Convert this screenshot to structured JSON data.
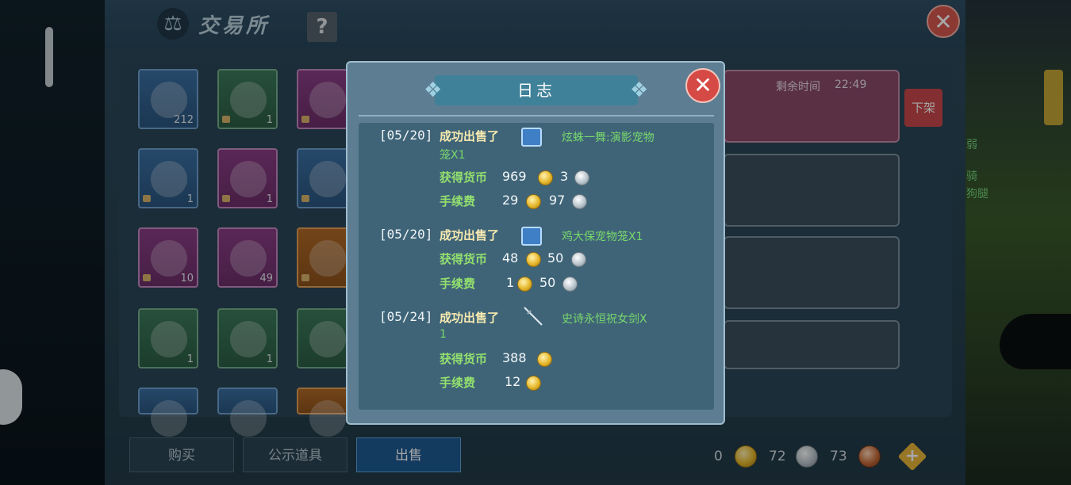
{
  "window": {
    "title": "交易所",
    "title_icon": "scales-icon",
    "help_label": "?",
    "close_label": "✕"
  },
  "inventory": [
    {
      "rarity": "blue",
      "icon": "cake-icon",
      "count": "212",
      "locked": false
    },
    {
      "rarity": "green",
      "icon": "blue-fish-mount-icon",
      "count": "1",
      "locked": true
    },
    {
      "rarity": "purple",
      "icon": "white-wardrobe-icon",
      "count": "",
      "locked": true
    },
    {
      "rarity": "blue",
      "icon": "cat-pet-icon",
      "count": "1",
      "locked": true
    },
    {
      "rarity": "purple",
      "icon": "cart-vehicle-icon",
      "count": "1",
      "locked": true
    },
    {
      "rarity": "blue",
      "icon": "disc-shield-icon",
      "count": "",
      "locked": true
    },
    {
      "rarity": "purple",
      "icon": "purple-gem-icon",
      "count": "10",
      "locked": true
    },
    {
      "rarity": "purple",
      "icon": "trident-icon",
      "count": "49",
      "locked": false
    },
    {
      "rarity": "orange",
      "icon": "horn-icon",
      "count": "",
      "locked": true
    },
    {
      "rarity": "green",
      "icon": "club-icon",
      "count": "1",
      "locked": false
    },
    {
      "rarity": "green",
      "icon": "boot-icon",
      "count": "1",
      "locked": false
    },
    {
      "rarity": "green",
      "icon": "saddle-icon",
      "count": "",
      "locked": false
    },
    {
      "rarity": "blue",
      "icon": "crystal-icon",
      "count": "",
      "locked": false
    },
    {
      "rarity": "blue",
      "icon": "grass-icon",
      "count": "",
      "locked": false
    },
    {
      "rarity": "orange",
      "icon": "arrow-icon",
      "count": "",
      "locked": false
    }
  ],
  "listings": {
    "remaining_label": "剩余时间",
    "remaining_time": "22:49",
    "unlist_label": "下架"
  },
  "side_texts": [
    "弱",
    "骑",
    "狗腿"
  ],
  "tabs": [
    {
      "label": "购买",
      "active": false
    },
    {
      "label": "公示道具",
      "active": false
    },
    {
      "label": "出售",
      "active": true
    }
  ],
  "currency": {
    "gold": "0",
    "silver": "72",
    "bronze": "73",
    "colors": {
      "gold": "#e6b72b",
      "silver": "#b9c5cc",
      "bronze": "#c56b3a"
    }
  },
  "log_dialog": {
    "title": "日志",
    "close_label": "✕",
    "fee_label": "手续费",
    "income_label": "获得货币",
    "entries": [
      {
        "date": "[05/20]",
        "action": "成功出售了",
        "item": "炫蛛一舞:演影宠物",
        "item_cont": "笼X1",
        "item_icon": "pet-cage-icon",
        "income_gold": "969",
        "income_silver": "3",
        "fee_gold": "29",
        "fee_silver": "97"
      },
      {
        "date": "[05/20]",
        "action": "成功出售了",
        "item": "鸡大保宠物笼X1",
        "item_icon": "pet-cage-icon",
        "income_gold": "48",
        "income_silver": "50",
        "fee_gold": "1",
        "fee_silver": "50"
      },
      {
        "date": "[05/24]",
        "action": "成功出售了",
        "item": "史诗永恒祝女剑X",
        "item_cont": "1",
        "item_icon": "sword-icon",
        "income_gold": "388",
        "fee_gold": "12"
      }
    ]
  }
}
